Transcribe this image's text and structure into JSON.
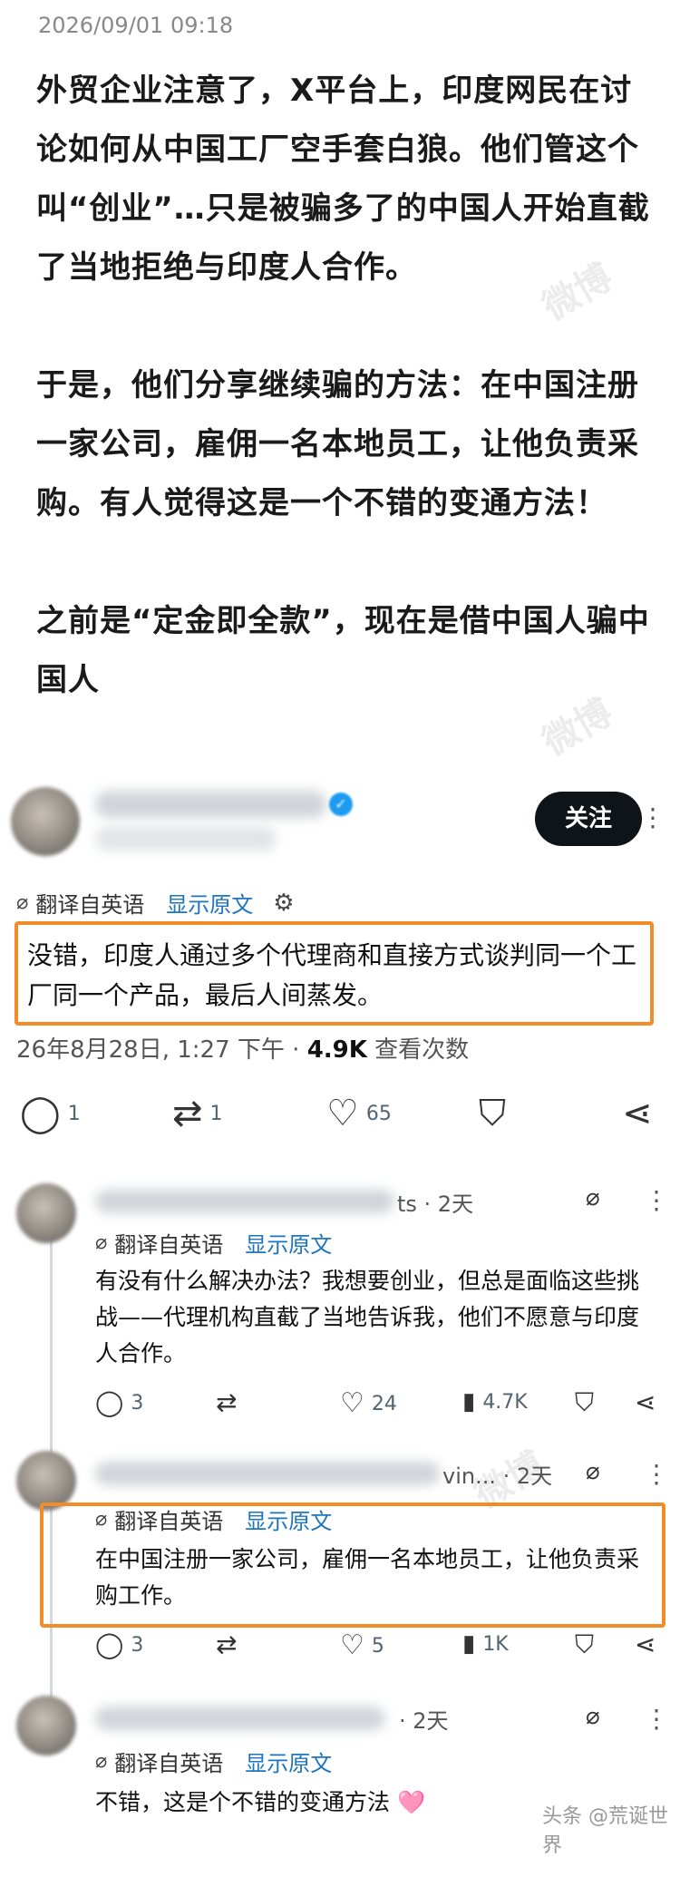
{
  "timestamp": "2026/09/01 09:18",
  "article": {
    "paragraphs": [
      "外贸企业注意了，X平台上，印度网民在讨论如何从中国工厂空手套白狼。他们管这个叫“创业”…只是被骗多了的中国人开始直截了当地拒绝与印度人合作。",
      "于是，他们分享继续骗的方法：在中国注册一家公司，雇佣一名本地员工，让他负责采购。有人觉得这是一个不错的变通方法！",
      "之前是“定金即全款”，现在是借中国人骗中国人"
    ]
  },
  "main_post": {
    "follow_label": "关注",
    "translate_label": "翻译自英语",
    "show_original_label": "显示原文",
    "text": "没错，印度人通过多个代理商和直接方式谈判同一个工厂同一个产品，最后人间蒸发。",
    "date": "26年8月28日, 1:27 下午 · ",
    "views": "4.9K",
    "views_label": " 查看次数",
    "stats": {
      "replies": "1",
      "reposts": "1",
      "likes": "65"
    }
  },
  "replies": [
    {
      "name_tail": "ts · 2天",
      "translate_label": "翻译自英语",
      "show_original_label": "显示原文",
      "text": "有没有什么解决办法？我想要创业，但总是面临这些挑战——代理机构直截了当地告诉我，他们不愿意与印度人合作。",
      "stats": {
        "replies": "3",
        "reposts": "",
        "likes": "24",
        "views": "4.7K"
      }
    },
    {
      "name_tail": "vin... · 2天",
      "translate_label": "翻译自英语",
      "show_original_label": "显示原文",
      "text": "在中国注册一家公司，雇佣一名本地员工，让他负责采购工作。",
      "stats": {
        "replies": "3",
        "reposts": "",
        "likes": "5",
        "views": "1K"
      }
    },
    {
      "name_tail": "· 2天",
      "translate_label": "翻译自英语",
      "show_original_label": "显示原文",
      "text": "不错，这是个不错的变通方法 ",
      "emoji": "🩷"
    }
  ],
  "watermark": "头条 @荒诞世界",
  "faint_watermark": "微博",
  "icons": {
    "follow": "avatar",
    "translate": "translate-icon",
    "settings": "gear-icon",
    "reply": "reply-icon",
    "repost": "repost-icon",
    "like": "heart-icon",
    "bookmark": "bookmark-icon",
    "share": "share-icon",
    "views": "views-icon",
    "grok": "grok-icon",
    "more": "more-icon"
  },
  "colors": {
    "highlight": "#f28c28",
    "link": "#1d74bf",
    "follow_bg": "#0f1419"
  }
}
